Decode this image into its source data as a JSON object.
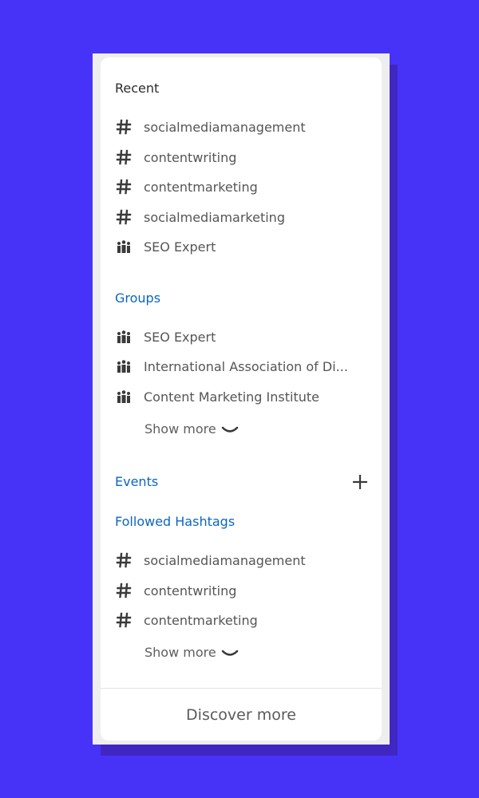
{
  "recent": {
    "title": "Recent",
    "items": [
      {
        "icon": "hashtag-icon",
        "label": "socialmediamanagement"
      },
      {
        "icon": "hashtag-icon",
        "label": "contentwriting"
      },
      {
        "icon": "hashtag-icon",
        "label": "contentmarketing"
      },
      {
        "icon": "hashtag-icon",
        "label": "socialmediamarketing"
      },
      {
        "icon": "group-icon",
        "label": "SEO Expert"
      }
    ]
  },
  "groups": {
    "title": "Groups",
    "items": [
      {
        "icon": "group-icon",
        "label": "SEO Expert"
      },
      {
        "icon": "group-icon",
        "label": "International Association of Di..."
      },
      {
        "icon": "group-icon",
        "label": "Content Marketing Institute"
      }
    ],
    "show_more": "Show more"
  },
  "events": {
    "title": "Events",
    "add_icon": "plus-icon"
  },
  "hashtags": {
    "title": "Followed Hashtags",
    "items": [
      {
        "icon": "hashtag-icon",
        "label": "socialmediamanagement"
      },
      {
        "icon": "hashtag-icon",
        "label": "contentwriting"
      },
      {
        "icon": "hashtag-icon",
        "label": "contentmarketing"
      }
    ],
    "show_more": "Show more"
  },
  "footer": {
    "discover_label": "Discover more"
  },
  "colors": {
    "background": "#4733f7",
    "link": "#0a66c2",
    "text": "#555555"
  }
}
